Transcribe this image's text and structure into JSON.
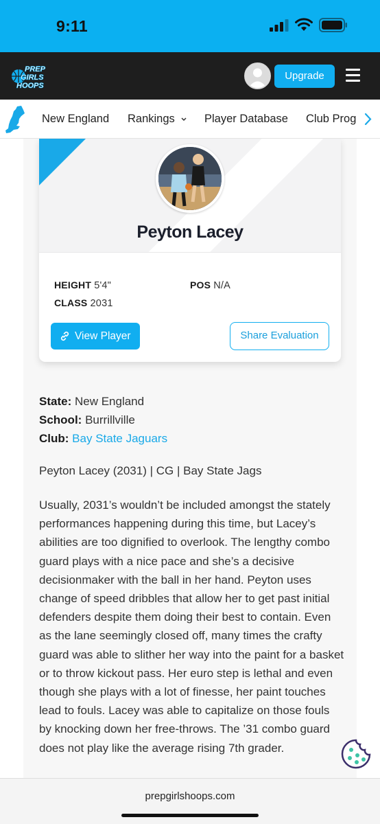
{
  "status": {
    "time": "9:11"
  },
  "nav": {
    "logo_text": [
      "PREP",
      "GIRLS",
      "HOOPS"
    ],
    "upgrade_label": "Upgrade"
  },
  "subnav": {
    "items": [
      {
        "label": "New England"
      },
      {
        "label": "Rankings"
      },
      {
        "label": "Player Database"
      },
      {
        "label": "Club Prog"
      }
    ]
  },
  "card": {
    "player_name": "Peyton Lacey",
    "height_label": "HEIGHT",
    "height_value": "5'4\"",
    "pos_label": "POS",
    "pos_value": "N/A",
    "class_label": "CLASS",
    "class_value": "2031",
    "view_player_label": "View Player",
    "share_label": "Share Evaluation"
  },
  "details": {
    "state_label": "State:",
    "state_value": "New England",
    "school_label": "School:",
    "school_value": "Burrillville",
    "club_label": "Club:",
    "club_value": "Bay State Jaguars"
  },
  "article": {
    "summary": "Peyton Lacey (2031) | CG | Bay State Jags",
    "paragraph": "Usually, 2031’s wouldn’t be included amongst the stately performances happening during this time, but Lacey’s abilities are too dignified to overlook. The lengthy combo guard plays with a nice pace and she’s a decisive decisionmaker with the ball in her hand. Peyton uses change of speed dribbles that allow her to get past initial defenders despite them doing their best to contain. Even as the lane seemingly closed off, many times the crafty guard was able to slither her way into the paint for a basket or to throw kickout pass. Her euro step is lethal and even though she plays with a lot of finesse, her paint touches lead to fouls. Lacey was able to capitalize on those fouls by knocking down her free-throws. The ’31 combo guard does not play like the average rising 7th grader."
  },
  "browser": {
    "url": "prepgirlshoops.com"
  },
  "colors": {
    "accent": "#11aef0",
    "status_bar": "#0bb0f1",
    "nav_bg": "#1e1e1e"
  }
}
